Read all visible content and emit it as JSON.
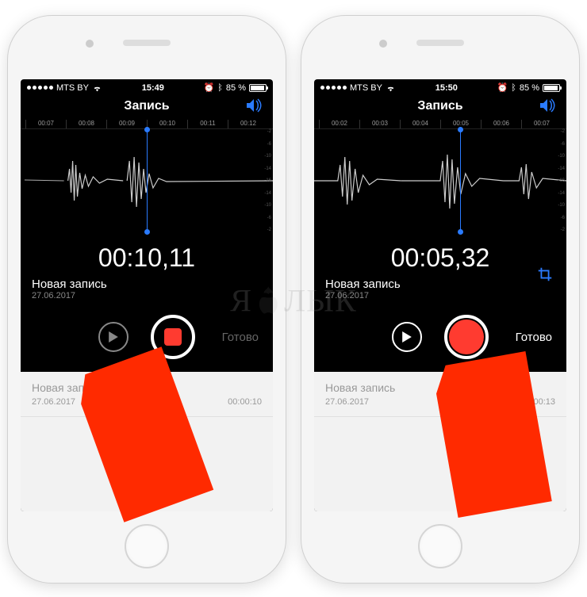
{
  "watermark_left": "Я",
  "watermark_right": "ЛЫК",
  "phones": [
    {
      "status": {
        "carrier": "MTS BY",
        "wifi": true,
        "time": "15:49",
        "alarm": true,
        "bt": true,
        "battery_pct": "85 %"
      },
      "header_title": "Запись",
      "ruler": [
        "00:07",
        "00:08",
        "00:09",
        "00:10",
        "00:11",
        "00:12"
      ],
      "playhead_pct": 50,
      "timer": "00:10,11",
      "rec_title": "Новая запись",
      "rec_date": "27.06.2017",
      "play_enabled": false,
      "rec_state": "recording",
      "done_label": "Готово",
      "done_enabled": false,
      "show_trim": false,
      "list": {
        "title": "Новая запись",
        "date": "27.06.2017",
        "duration": "00:00:10"
      },
      "arrow_target": "record"
    },
    {
      "status": {
        "carrier": "MTS BY",
        "wifi": true,
        "time": "15:50",
        "alarm": true,
        "bt": true,
        "battery_pct": "85 %"
      },
      "header_title": "Запись",
      "ruler": [
        "00:02",
        "00:03",
        "00:04",
        "00:05",
        "00:06",
        "00:07"
      ],
      "playhead_pct": 58,
      "timer": "00:05,32",
      "rec_title": "Новая запись",
      "rec_date": "27.06.2017",
      "play_enabled": true,
      "rec_state": "stopped",
      "done_label": "Готово",
      "done_enabled": true,
      "show_trim": true,
      "list": {
        "title": "Новая запись",
        "date": "27.06.2017",
        "duration": "00:00:13"
      },
      "arrow_target": "done"
    }
  ],
  "side_scale": [
    "-2",
    "-6",
    "-10",
    "-14",
    "-16",
    "-14",
    "-10",
    "-6",
    "-2"
  ]
}
